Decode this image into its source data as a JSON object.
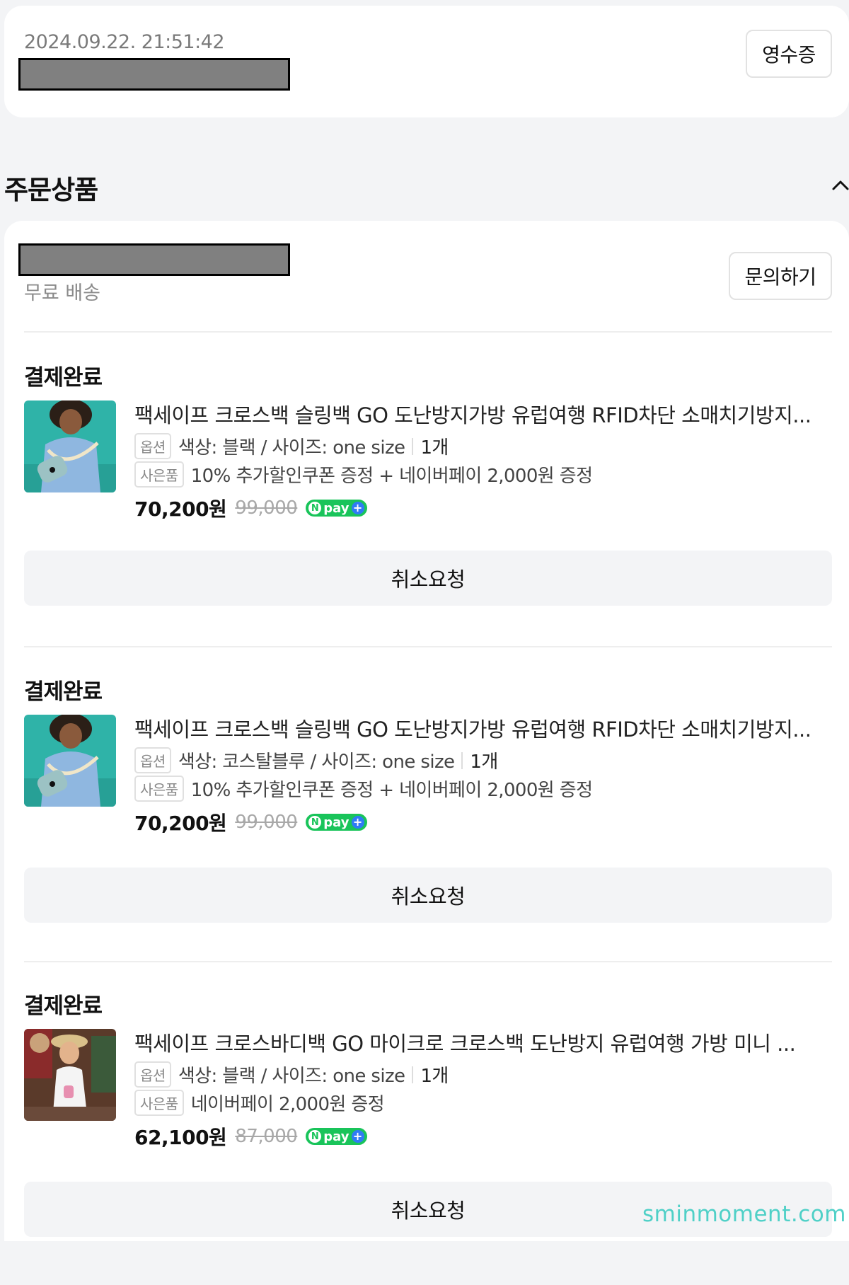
{
  "order": {
    "datetime": "2024.09.22. 21:51:42",
    "receipt_label": "영수증"
  },
  "section": {
    "title": "주문상품"
  },
  "seller": {
    "shipping": "무료 배송",
    "inquiry_label": "문의하기"
  },
  "items": [
    {
      "status": "결제완료",
      "name": "팩세이프 크로스백 슬링백 GO 도난방지가방 유럽여행 RFID차단 소매치기방지...",
      "option_tag": "옵션",
      "option": "색상: 블랙 / 사이즈: one size",
      "qty": "1개",
      "gift_tag": "사은품",
      "gift": "10% 추가할인쿠폰 증정 + 네이버페이 2,000원 증정",
      "price": "70,200원",
      "original_price": "99,000",
      "npay_label": "pay",
      "cancel_label": "취소요청"
    },
    {
      "status": "결제완료",
      "name": "팩세이프 크로스백 슬링백 GO 도난방지가방 유럽여행 RFID차단 소매치기방지...",
      "option_tag": "옵션",
      "option": "색상: 코스탈블루 / 사이즈: one size",
      "qty": "1개",
      "gift_tag": "사은품",
      "gift": "10% 추가할인쿠폰 증정 + 네이버페이 2,000원 증정",
      "price": "70,200원",
      "original_price": "99,000",
      "npay_label": "pay",
      "cancel_label": "취소요청"
    },
    {
      "status": "결제완료",
      "name": "팩세이프 크로스바디백 GO 마이크로 크로스백 도난방지 유럽여행 가방 미니 ...",
      "option_tag": "옵션",
      "option": "색상: 블랙 / 사이즈: one size",
      "qty": "1개",
      "gift_tag": "사은품",
      "gift": "네이버페이 2,000원 증정",
      "price": "62,100원",
      "original_price": "87,000",
      "npay_label": "pay",
      "cancel_label": "취소요청"
    }
  ],
  "watermark": "sminmoment.com",
  "colors": {
    "background": "#f3f4f6",
    "card": "#ffffff",
    "npay_green": "#19c45a",
    "redaction": "#808080"
  }
}
